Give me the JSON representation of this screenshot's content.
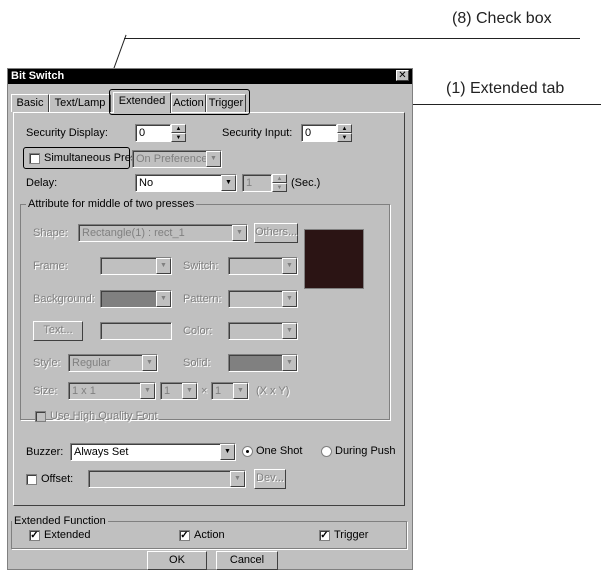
{
  "callouts": {
    "check_box": "(8) Check box",
    "extended_tab": "(1) Extended tab"
  },
  "dialog": {
    "title": "Bit Switch",
    "close_symbol": "✕",
    "tabs": [
      "Basic",
      "Text/Lamp",
      "Extended",
      "Action",
      "Trigger"
    ],
    "active_tab": "Extended"
  },
  "security": {
    "display_label": "Security Display:",
    "display_value": "0",
    "input_label": "Security Input:",
    "input_value": "0"
  },
  "simultaneous": {
    "label": "Simultaneous Press:",
    "checked": false,
    "value": "On Preference"
  },
  "delay": {
    "label": "Delay:",
    "value": "No",
    "count": "1",
    "unit": "(Sec.)"
  },
  "middle_attr": {
    "title": "Attribute for middle of two presses",
    "shape_label": "Shape:",
    "shape_value": "Rectangle(1) : rect_1",
    "others_button": "Others...",
    "frame_label": "Frame:",
    "switch_label": "Switch:",
    "background_label": "Background:",
    "pattern_label": "Pattern:",
    "text_button": "Text...",
    "color_label": "Color:",
    "style_label": "Style:",
    "style_value": "Regular",
    "solid_label": "Solid:",
    "size_label": "Size:",
    "size_value": "1 x 1",
    "size_x": "1",
    "size_times": "×",
    "size_y": "1",
    "size_unit": "(X x Y)",
    "hq_font_label": "Use High Quality Font",
    "swatch_color": "#2b1414"
  },
  "buzzer": {
    "label": "Buzzer:",
    "value": "Always Set",
    "one_shot": "One Shot",
    "during_push": "During Push",
    "selected": "One Shot"
  },
  "offset": {
    "label": "Offset:",
    "dev_button": "Dev..."
  },
  "extended_function": {
    "title": "Extended Function",
    "items": [
      {
        "label": "Extended",
        "checked": true
      },
      {
        "label": "Action",
        "checked": true
      },
      {
        "label": "Trigger",
        "checked": true
      }
    ]
  },
  "buttons": {
    "ok": "OK",
    "cancel": "Cancel"
  },
  "glyphs": {
    "check": "✓",
    "dropdown": "▼",
    "spin_up": "▲",
    "spin_down": "▼"
  }
}
